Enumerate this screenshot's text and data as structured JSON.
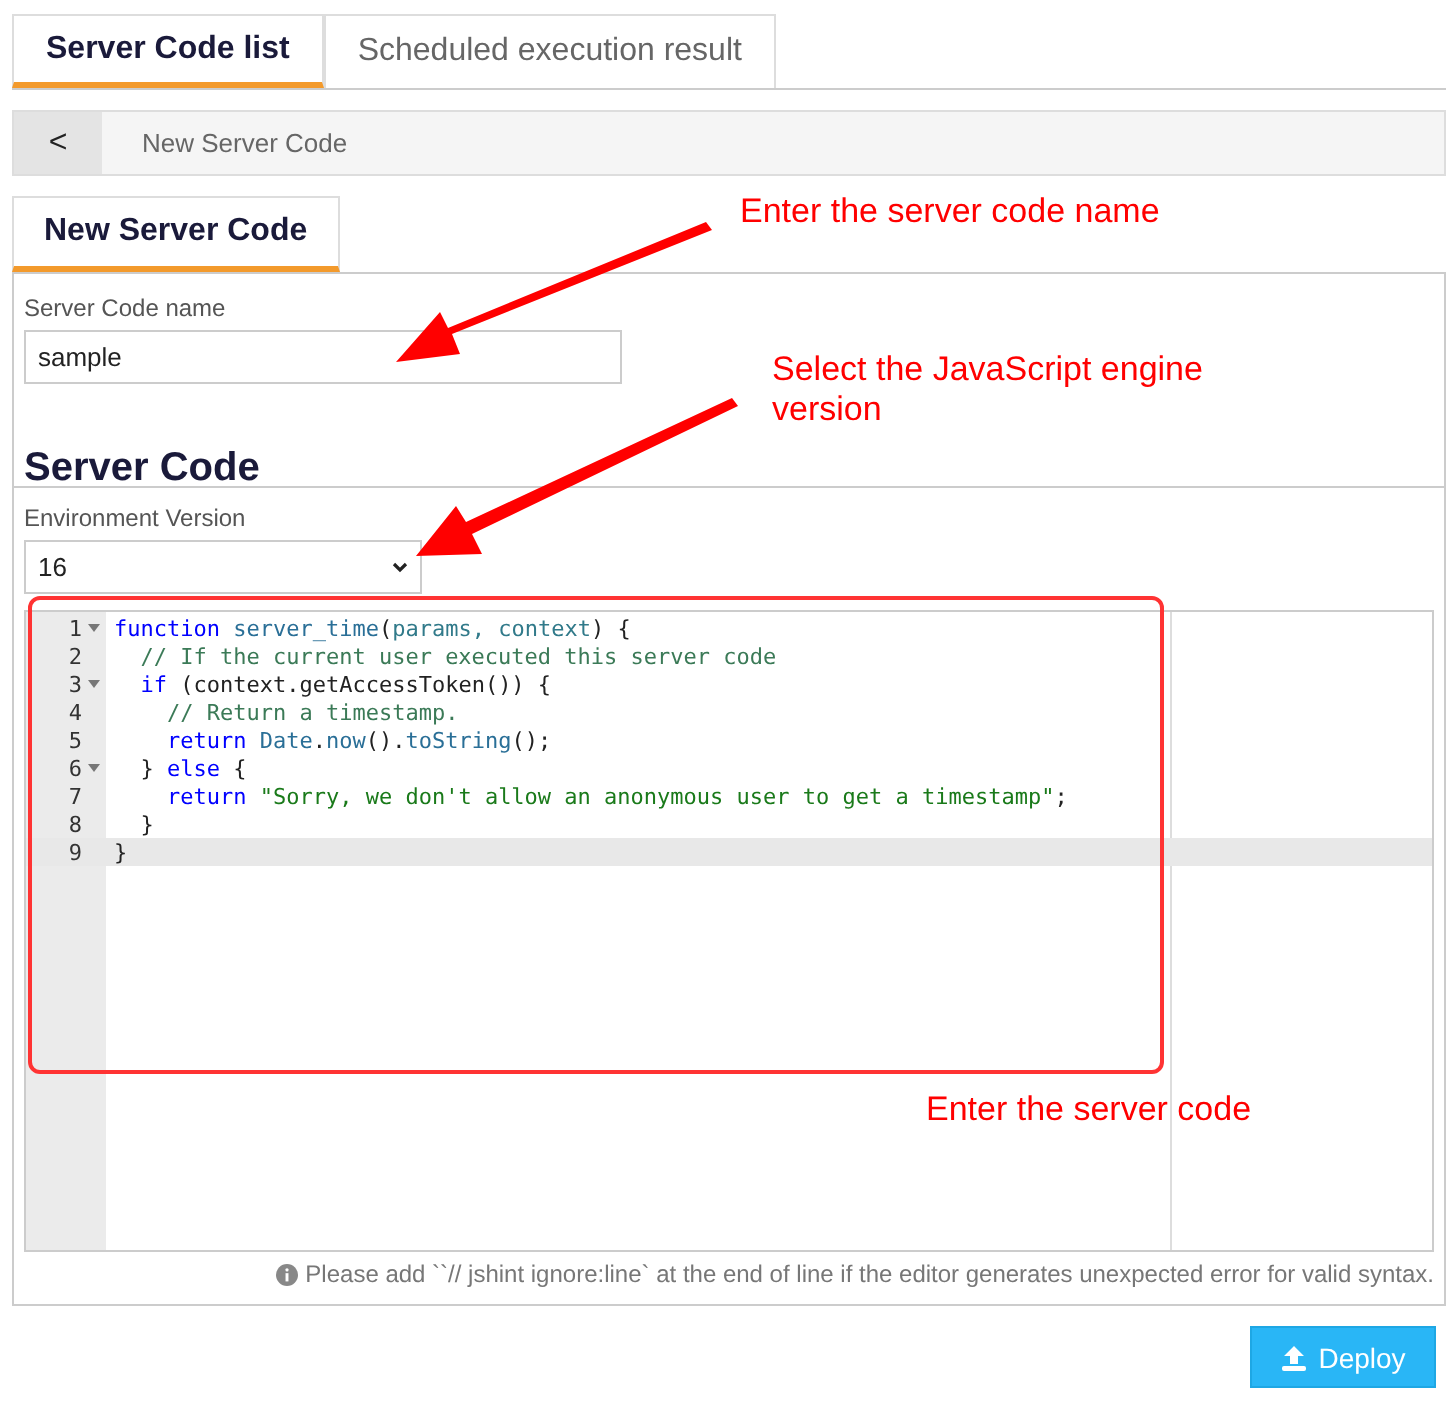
{
  "tabs": [
    {
      "label": "Server Code list",
      "selected": true
    },
    {
      "label": "Scheduled execution result",
      "selected": false
    }
  ],
  "breadcrumb": {
    "back": "<",
    "title": "New Server Code"
  },
  "subtabs": [
    {
      "label": "New Server Code",
      "selected": true
    }
  ],
  "form": {
    "name_label": "Server Code name",
    "name_value": "sample",
    "section_title": "Server Code",
    "env_label": "Environment Version",
    "env_value": "16"
  },
  "editor": {
    "lines": [
      {
        "number": "1",
        "foldable": true,
        "active": false,
        "tokens": [
          {
            "t": "function",
            "kind": "keyword"
          },
          {
            "t": " server_time",
            "kind": "name"
          },
          {
            "t": "(",
            "kind": "plain"
          },
          {
            "t": "params",
            "kind": "param"
          },
          {
            "t": ", context",
            "kind": "param"
          },
          {
            "t": ") {",
            "kind": "plain"
          }
        ]
      },
      {
        "number": "2",
        "foldable": false,
        "active": false,
        "tokens": [
          {
            "t": "  // If the current user executed this server code",
            "kind": "comment"
          }
        ]
      },
      {
        "number": "3",
        "foldable": true,
        "active": false,
        "tokens": [
          {
            "t": "  if",
            "kind": "keyword"
          },
          {
            "t": " (context.getAccessToken()) {",
            "kind": "plain"
          }
        ]
      },
      {
        "number": "4",
        "foldable": false,
        "active": false,
        "tokens": [
          {
            "t": "    // Return a timestamp.",
            "kind": "comment"
          }
        ]
      },
      {
        "number": "5",
        "foldable": false,
        "active": false,
        "tokens": [
          {
            "t": "    return",
            "kind": "keyword"
          },
          {
            "t": " Date",
            "kind": "name"
          },
          {
            "t": ".",
            "kind": "plain"
          },
          {
            "t": "now",
            "kind": "name"
          },
          {
            "t": "().",
            "kind": "plain"
          },
          {
            "t": "toString",
            "kind": "name"
          },
          {
            "t": "();",
            "kind": "plain"
          }
        ]
      },
      {
        "number": "6",
        "foldable": true,
        "active": false,
        "tokens": [
          {
            "t": "  }",
            "kind": "plain"
          },
          {
            "t": " else",
            "kind": "keyword"
          },
          {
            "t": " {",
            "kind": "plain"
          }
        ]
      },
      {
        "number": "7",
        "foldable": false,
        "active": false,
        "tokens": [
          {
            "t": "    return",
            "kind": "keyword"
          },
          {
            "t": " \"Sorry, we don't allow an anonymous user to get a timestamp\"",
            "kind": "string"
          },
          {
            "t": ";",
            "kind": "plain"
          }
        ]
      },
      {
        "number": "8",
        "foldable": false,
        "active": false,
        "tokens": [
          {
            "t": "  }",
            "kind": "plain"
          }
        ]
      },
      {
        "number": "9",
        "foldable": false,
        "active": true,
        "tokens": [
          {
            "t": "}",
            "kind": "plain"
          }
        ]
      }
    ]
  },
  "note": "Please add ``// jshint ignore:line` at the end of line if the editor generates unexpected error for valid syntax.",
  "deploy_button": "Deploy",
  "annotations": [
    {
      "text": "Enter the server code name"
    },
    {
      "text": "Select the JavaScript engine version"
    },
    {
      "text": "Enter the server code"
    }
  ]
}
